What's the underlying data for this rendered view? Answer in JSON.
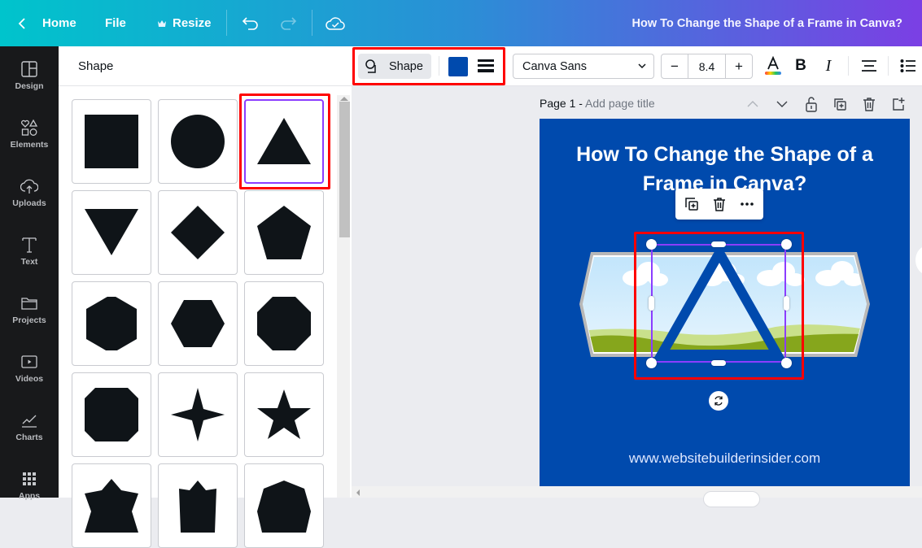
{
  "topbar": {
    "home_label": "Home",
    "file_label": "File",
    "resize_label": "Resize",
    "document_title": "How To Change the Shape of a Frame in Canva?"
  },
  "sidebar": {
    "items": [
      {
        "label": "Design",
        "icon": "layout-icon"
      },
      {
        "label": "Elements",
        "icon": "shapes-icon"
      },
      {
        "label": "Uploads",
        "icon": "cloud-upload-icon"
      },
      {
        "label": "Text",
        "icon": "text-icon"
      },
      {
        "label": "Projects",
        "icon": "folder-icon"
      },
      {
        "label": "Videos",
        "icon": "video-icon"
      },
      {
        "label": "Charts",
        "icon": "chart-line-icon"
      },
      {
        "label": "Apps",
        "icon": "grid-icon"
      }
    ]
  },
  "panel": {
    "title": "Shape",
    "shapes": [
      "square",
      "circle",
      "triangle",
      "inverted-triangle",
      "diamond",
      "pentagon",
      "hexagon",
      "hexagon-horizontal",
      "octagon",
      "rounded-octagon",
      "four-point-star",
      "five-point-star",
      "star-partial",
      "crown-partial",
      "heptagon-partial"
    ],
    "selected_shape": "triangle"
  },
  "toolbar": {
    "shape_label": "Shape",
    "fill_color": "#004aad",
    "font_name": "Canva Sans",
    "font_size": "8.4",
    "minus_label": "−",
    "plus_label": "+"
  },
  "page": {
    "label": "Page 1 - ",
    "title_placeholder": "Add page title"
  },
  "canvas": {
    "title": "How To Change the Shape of a Frame in Canva?",
    "url": "www.websitebuilderinsider.com",
    "background_color": "#004aad",
    "selection_color": "#8b3dff",
    "highlight_color": "#ff0000"
  }
}
